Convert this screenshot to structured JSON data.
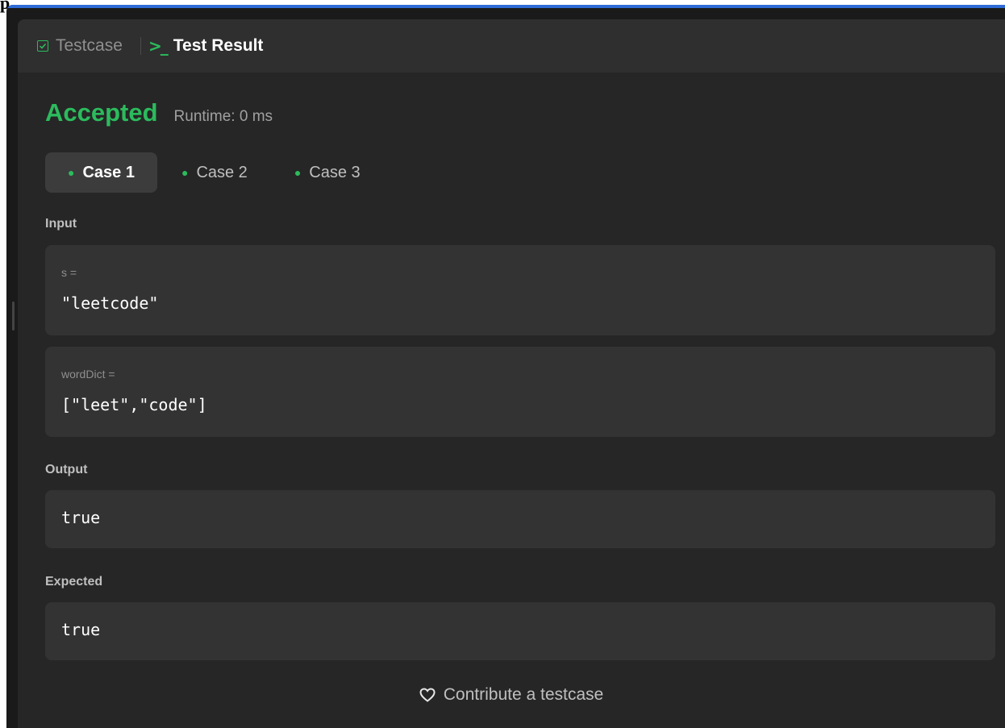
{
  "tabs": {
    "testcase_label": "Testcase",
    "result_label": "Test Result",
    "terminal_icon": ">_"
  },
  "status": {
    "verdict": "Accepted",
    "runtime": "Runtime: 0 ms"
  },
  "cases": [
    {
      "label": "Case 1",
      "active": true
    },
    {
      "label": "Case 2",
      "active": false
    },
    {
      "label": "Case 3",
      "active": false
    }
  ],
  "input": {
    "label": "Input",
    "params": [
      {
        "name": "s =",
        "value": "\"leetcode\""
      },
      {
        "name": "wordDict =",
        "value": "[\"leet\",\"code\"]"
      }
    ]
  },
  "output": {
    "label": "Output",
    "value": "true"
  },
  "expected": {
    "label": "Expected",
    "value": "true"
  },
  "contribute": {
    "label": "Contribute a testcase"
  },
  "colors": {
    "accent_green": "#2cbb5d",
    "accent_blue": "#2f6bd6",
    "panel_bg": "#262626",
    "box_bg": "#333333"
  },
  "icons": [
    "check-icon",
    "terminal-icon",
    "heart-icon"
  ]
}
